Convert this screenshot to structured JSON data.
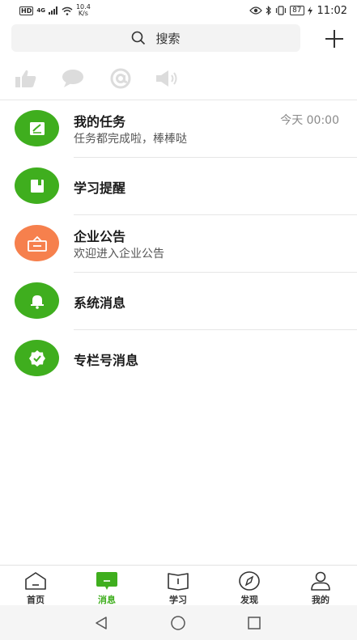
{
  "status_bar": {
    "hd": "HD",
    "network": "4G",
    "speed_value": "10.4",
    "speed_unit": "K/s",
    "battery": "87",
    "time": "11:02"
  },
  "search": {
    "label": "搜索"
  },
  "messages": [
    {
      "title": "我的任务",
      "subtitle": "任务都完成啦，棒棒哒",
      "time": "今天 00:00",
      "icon": "task-icon",
      "color": "#3fae1e"
    },
    {
      "title": "学习提醒",
      "subtitle": "",
      "time": "",
      "icon": "study-reminder-icon",
      "color": "#3fae1e"
    },
    {
      "title": "企业公告",
      "subtitle": "欢迎进入企业公告",
      "time": "",
      "icon": "announcement-icon",
      "color": "#f6804d"
    },
    {
      "title": "系统消息",
      "subtitle": "",
      "time": "",
      "icon": "bell-icon",
      "color": "#3fae1e"
    },
    {
      "title": "专栏号消息",
      "subtitle": "",
      "time": "",
      "icon": "badge-check-icon",
      "color": "#3fae1e"
    }
  ],
  "bottom_nav": [
    {
      "label": "首页",
      "icon": "home-icon"
    },
    {
      "label": "消息",
      "icon": "message-icon",
      "active": true
    },
    {
      "label": "学习",
      "icon": "book-icon"
    },
    {
      "label": "发现",
      "icon": "compass-icon"
    },
    {
      "label": "我的",
      "icon": "user-icon"
    }
  ],
  "colors": {
    "accent": "#3fae1e",
    "orange": "#f6804d"
  }
}
